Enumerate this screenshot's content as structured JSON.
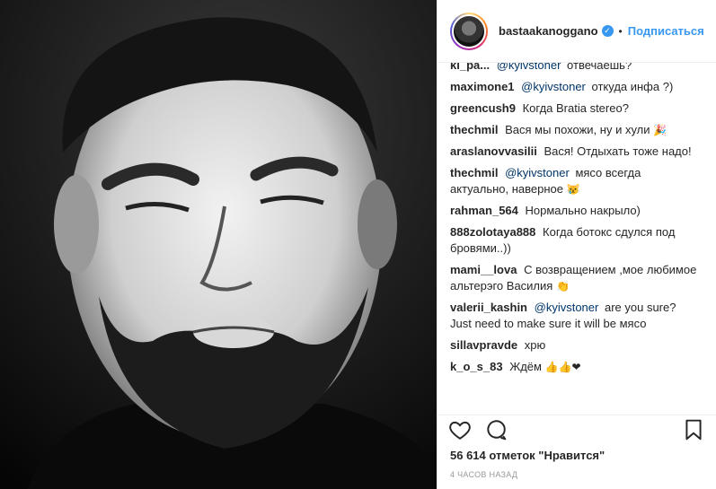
{
  "post": {
    "username": "bastaakanoggano",
    "verified_icon": "verified-badge-icon",
    "separator": "•",
    "follow_label": "Подписаться",
    "likes": "56 614 отметок \"Нравится\"",
    "timestamp": "4 часов назад"
  },
  "comments": [
    {
      "user": "ki_pa...",
      "mention": "@kyivstoner",
      "text": "отвечаешь?"
    },
    {
      "user": "maximone1",
      "mention": "@kyivstoner",
      "text": "откуда инфа ?)"
    },
    {
      "user": "greencush9",
      "mention": "",
      "text": "Когда Bratia stereo?"
    },
    {
      "user": "thechmil",
      "mention": "",
      "text": "Вася мы похожи, ну и хули",
      "emoji": "🎉"
    },
    {
      "user": "araslanovvasilii",
      "mention": "",
      "text": "Вася! Отдыхать тоже надо!"
    },
    {
      "user": "thechmil",
      "mention": "@kyivstoner",
      "text": "мясо всегда актуально, наверное",
      "emoji": "😿"
    },
    {
      "user": "rahman_564",
      "mention": "",
      "text": "Нормально накрыло)"
    },
    {
      "user": "888zolotaya888",
      "mention": "",
      "text": "Когда ботокс сдулся под бровями..))"
    },
    {
      "user": "mami__lova",
      "mention": "",
      "text": "С возвращением ,мое любимое альтерэго Василия",
      "emoji": "👏"
    },
    {
      "user": "valerii_kashin",
      "mention": "@kyivstoner",
      "text": "are you sure? Just need to make sure it will be мясо"
    },
    {
      "user": "sillavpravde",
      "mention": "",
      "text": "хрю"
    },
    {
      "user": "k_o_s_83",
      "mention": "",
      "text": "Ждём",
      "emoji": "👍👍❤"
    }
  ],
  "icons": {
    "like": "heart-icon",
    "comment": "comment-bubble-icon",
    "save": "bookmark-icon"
  },
  "colors": {
    "accent": "#3897f0",
    "mention": "#003569",
    "muted": "#999999",
    "border": "#efefef"
  }
}
